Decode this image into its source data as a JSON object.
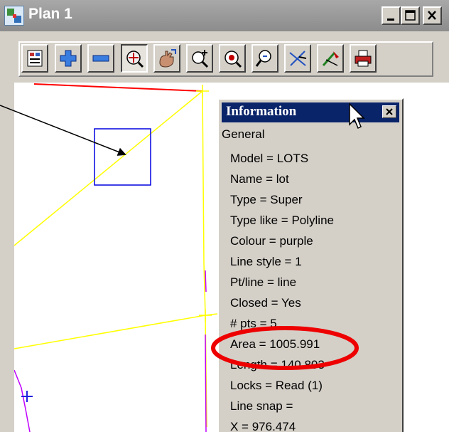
{
  "window": {
    "title": "Plan 1",
    "controls": [
      "minimize",
      "maximize",
      "close"
    ]
  },
  "toolbar": {
    "buttons": [
      {
        "icon": "plot-icon",
        "pressed": false
      },
      {
        "icon": "zoom-in-icon",
        "pressed": false
      },
      {
        "icon": "zoom-out-icon",
        "pressed": false
      },
      {
        "icon": "zoom-extent-icon",
        "pressed": true
      },
      {
        "icon": "pan-icon",
        "pressed": false
      },
      {
        "icon": "zoom-point-icon",
        "pressed": false
      },
      {
        "icon": "zoom-window-icon",
        "pressed": false
      },
      {
        "icon": "query-icon",
        "pressed": false
      },
      {
        "icon": "cross-hair-icon",
        "pressed": false
      },
      {
        "icon": "pick-icon",
        "pressed": false
      },
      {
        "icon": "print-icon",
        "pressed": false
      }
    ]
  },
  "info_panel": {
    "title": "Information",
    "section": "General",
    "rows": [
      "Model = LOTS",
      "Name = lot",
      "Type = Super",
      "Type like = Polyline",
      "Colour = purple",
      "Line style = 1",
      "Pt/line = line",
      "Closed = Yes",
      "# pts = 5",
      "Area = 1005.991",
      "Length = 140.803",
      "Locks = Read (1)",
      "Line snap =",
      "X = 976.474"
    ],
    "highlighted_row": "Area = 1005.991"
  },
  "colors": {
    "title_bar": "#8c8c8c",
    "panel_header": "#0a246a",
    "face": "#d4d0c8",
    "line_yellow": "#ffff00",
    "line_red": "#ff0000",
    "line_purple": "#c000ff",
    "pick_box": "#0000e0",
    "highlight_ellipse": "#ee0000"
  }
}
